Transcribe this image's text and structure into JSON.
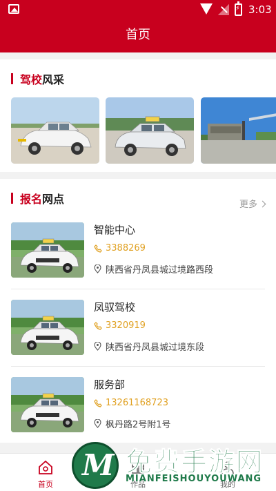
{
  "status_bar": {
    "time": "3:03"
  },
  "header": {
    "title": "首页"
  },
  "style_section": {
    "title_highlight": "驾校",
    "title_rest": "风采",
    "images": [
      "car-photo",
      "car-photo",
      "school-gate-photo"
    ]
  },
  "points_section": {
    "title_highlight": "报名",
    "title_rest": "网点",
    "more_label": "更多",
    "items": [
      {
        "name": "智能中心",
        "phone": "3388269",
        "address": "陕西省丹凤县城过境路西段"
      },
      {
        "name": "凤驭驾校",
        "phone": "3320919",
        "address": "陕西省丹凤县城过境东段"
      },
      {
        "name": "服务部",
        "phone": "13261168723",
        "address": "枫丹路2号附1号"
      }
    ]
  },
  "tabbar": {
    "tabs": [
      {
        "label": "首页",
        "icon": "home-icon",
        "active": true
      },
      {
        "label": "作品",
        "icon": "works-icon",
        "active": false
      },
      {
        "label": "我的",
        "icon": "profile-icon",
        "active": false
      }
    ]
  },
  "watermark": {
    "title": "免费手游网",
    "subtitle": "MIANFEISHOUYOUWANG",
    "logo_letter": "M"
  },
  "colors": {
    "accent": "#c8001e",
    "phone": "#e0a020",
    "watermark": "#1f7a4a"
  }
}
